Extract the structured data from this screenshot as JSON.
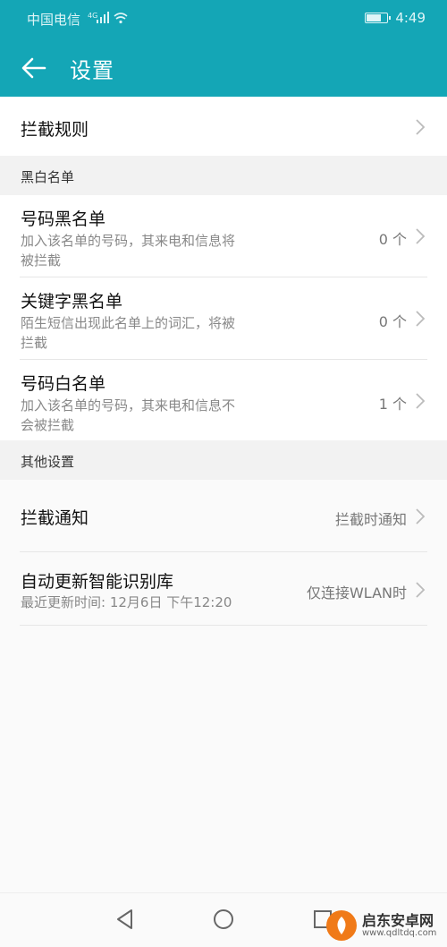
{
  "status_bar": {
    "carrier": "中国电信",
    "network": "4G",
    "time": "4:49",
    "battery_level": 0.75
  },
  "app_bar": {
    "title": "设置"
  },
  "intercept_rules": {
    "label": "拦截规则"
  },
  "blackwhite": {
    "header": "黑白名单",
    "items": [
      {
        "label": "号码黑名单",
        "desc1": "加入该名单的号码，其来电和信息将",
        "desc2": "被拦截",
        "value": "0 个"
      },
      {
        "label": "关键字黑名单",
        "desc1": "陌生短信出现此名单上的词汇，将被",
        "desc2": "拦截",
        "value": "0 个"
      },
      {
        "label": "号码白名单",
        "desc1": "加入该名单的号码，其来电和信息不",
        "desc2": "会被拦截",
        "value": "1 个"
      }
    ]
  },
  "other": {
    "header": "其他设置",
    "notify": {
      "label": "拦截通知",
      "value": "拦截时通知"
    },
    "update": {
      "label": "自动更新智能识别库",
      "desc": "最近更新时间: 12月6日 下午12:20",
      "value": "仅连接WLAN时"
    }
  },
  "watermark": {
    "brand": "启东安卓网",
    "url": "www.qdltdq.com"
  },
  "colors": {
    "accent": "#14a6b6"
  }
}
